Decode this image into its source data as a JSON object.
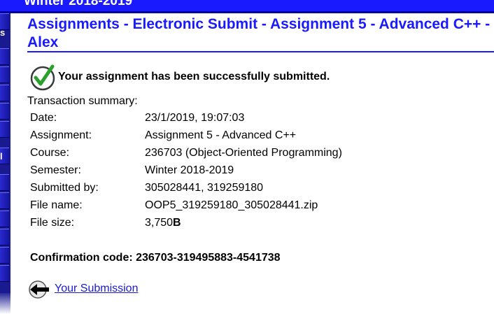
{
  "header": {
    "title": "Winter 2018-2019"
  },
  "side_nav": {
    "visible_letters": [
      "s",
      "l"
    ]
  },
  "page": {
    "heading": "Assignments - Electronic Submit - Assignment 5 - Advanced C++ - Alex",
    "success_message": "Your assignment has been successfully submitted.",
    "summary_heading": "Transaction summary:",
    "summary": [
      {
        "label": "Date:",
        "value": "23/1/2019, 19:07:03"
      },
      {
        "label": "Assignment:",
        "value": "Assignment 5 - Advanced C++"
      },
      {
        "label": "Course:",
        "value": "236703 (Object-Oriented Programming)"
      },
      {
        "label": "Semester:",
        "value": "Winter 2018-2019"
      },
      {
        "label": "Submitted by:",
        "value": "305028441, 319259180"
      },
      {
        "label": "File name:",
        "value": "OOP5_319259180_305028441.zip"
      },
      {
        "label": "File size:",
        "value": "3,750",
        "unit": "B"
      }
    ],
    "confirmation": "Confirmation code: 236703-319495883-4541738",
    "back_link": "Your Submission"
  },
  "icons": {
    "success": "check-circle-icon",
    "back": "arrow-left-icon"
  },
  "colors": {
    "accent": "#1a1aff",
    "nav": "#1a1a90",
    "check": "#2aa02a",
    "link": "#1a1ad0"
  }
}
